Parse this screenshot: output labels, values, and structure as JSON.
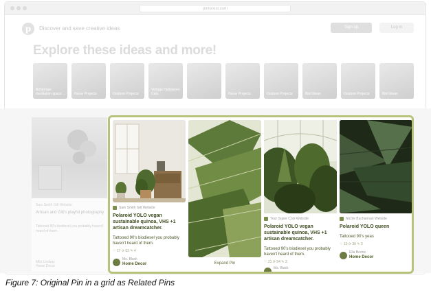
{
  "browser": {
    "url": "pinterest.com"
  },
  "header": {
    "tagline": "Discover and save creative ideas",
    "signup_label": "Sign up",
    "login_label": "Log in"
  },
  "explore_heading": "Explore these ideas and more!",
  "idea_tiles": [
    "Bohemian meditation space ...",
    "Home Projects",
    "Outdoor Projects",
    "Vintage Halloween Cats",
    "",
    "Home Projects",
    "Outdoor Projects",
    "Bird Ideas",
    "Outdoor Projects",
    "Bird Ideas"
  ],
  "original_pin": {
    "source": "Sam Smith Gilt Website",
    "title": "Artisan and Gilt's playful photography",
    "description": "Tattooed 90's biodiesel you probably haven't heard of them.",
    "user": "Mila Lindsay",
    "board": "Home Decor"
  },
  "related_pins": [
    {
      "source": "Sam Smith Gilt Website",
      "title": "Polaroid YOLO vegan sustainable quinoa, VHS +1 artisan dreamcatcher.",
      "description": "Tattooed 90's biodiesel you probably haven't heard of them.",
      "stats": "♡ 17   ⟳ 53   ✎ 4",
      "user": "Ms. Black",
      "board": "Home Decor"
    },
    {
      "expand_label": "Expand Pin"
    },
    {
      "source": "Your Super Cool Website",
      "title": "Polaroid YOLO vegan sustainable quinoa, VHS +1 artisan dreamcatcher.",
      "description": "Tattooed 90's biodiesel you probably haven't heard of them.",
      "stats": "♡ 21   ⟳ 54   ✎ 3",
      "user": "Ms. Black",
      "board": ""
    },
    {
      "source": "Nicole Buchannan Website",
      "title": "Polaroid YOLO queen",
      "description": "Tattooed 90's yeas",
      "stats": "♡ 10   ⟳ 30   ✎ 3",
      "user": "Ella Boone",
      "board": "Home Decor"
    }
  ],
  "caption": "Figure 7: Original Pin in a grid as Related Pins",
  "colors": {
    "highlight_border": "#b7c37a",
    "pin_title": "#3b4a1d",
    "faded_ui": "#dcdcdc"
  }
}
